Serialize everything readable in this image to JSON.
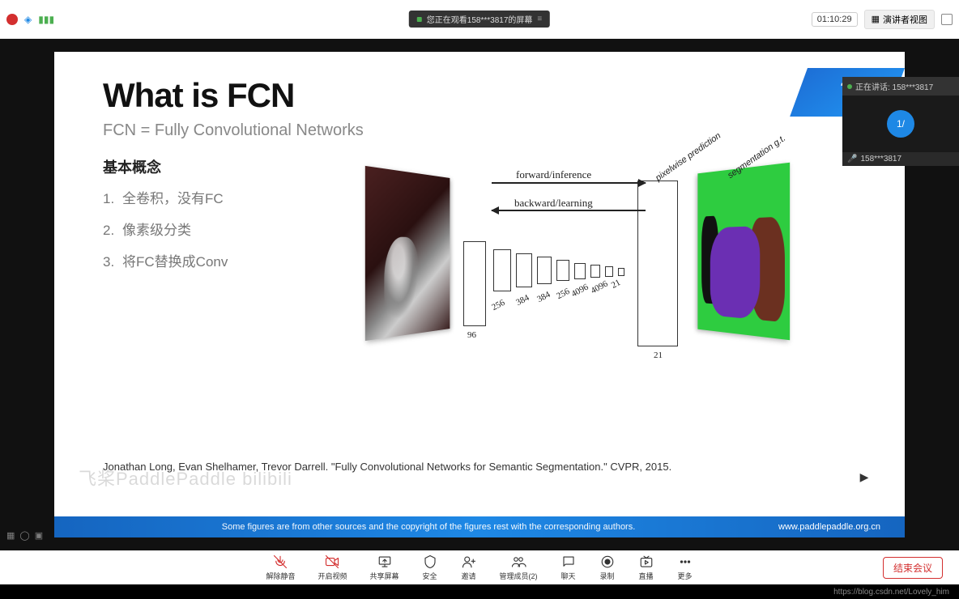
{
  "topbar": {
    "share_notice": "您正在观看158***3817的屏幕",
    "time": "01:10:29",
    "presenter_btn": "演讲者视图"
  },
  "participant": {
    "speaking_label": "正在讲话: 158***3817",
    "avatar_text": "1/",
    "name": "158***3817"
  },
  "slide": {
    "title": "What is FCN",
    "subtitle": "FCN = Fully Convolutional Networks",
    "concept_title": "基本概念",
    "concepts": [
      "全卷积，没有FC",
      "像素级分类",
      "将FC替换成Conv"
    ],
    "diagram": {
      "forward": "forward/inference",
      "backward": "backward/learning",
      "pixelwise": "pixelwise prediction",
      "seggt": "segmentation g.t.",
      "dims": {
        "d96": "96",
        "d256": "256",
        "d384a": "384",
        "d384b": "384",
        "d256b": "256",
        "d4096a": "4096",
        "d4096b": "4096",
        "d21a": "21",
        "d21b": "21"
      }
    },
    "citation": "Jonathan Long, Evan Shelhamer, Trevor Darrell. \"Fully Convolutional Networks for Semantic Segmentation.\" CVPR, 2015.",
    "footer_copy": "Some figures are from other sources and the copyright of the figures rest with the corresponding authors.",
    "footer_link": "www.paddlepaddle.org.cn",
    "corner_logo": "飞"
  },
  "watermark": "飞桨PaddlePaddle  bilibili",
  "toolbar": {
    "items": [
      {
        "label": "解除静音",
        "name": "mute-button",
        "red": true
      },
      {
        "label": "开启视频",
        "name": "video-button",
        "red": true
      },
      {
        "label": "共享屏幕",
        "name": "share-button"
      },
      {
        "label": "安全",
        "name": "security-button"
      },
      {
        "label": "邀请",
        "name": "invite-button"
      },
      {
        "label": "管理成员(2)",
        "name": "members-button"
      },
      {
        "label": "聊天",
        "name": "chat-button"
      },
      {
        "label": "录制",
        "name": "record-button"
      },
      {
        "label": "直播",
        "name": "live-button"
      },
      {
        "label": "更多",
        "name": "more-button"
      }
    ],
    "end": "结束会议"
  },
  "footer_url": "https://blog.csdn.net/Lovely_him"
}
